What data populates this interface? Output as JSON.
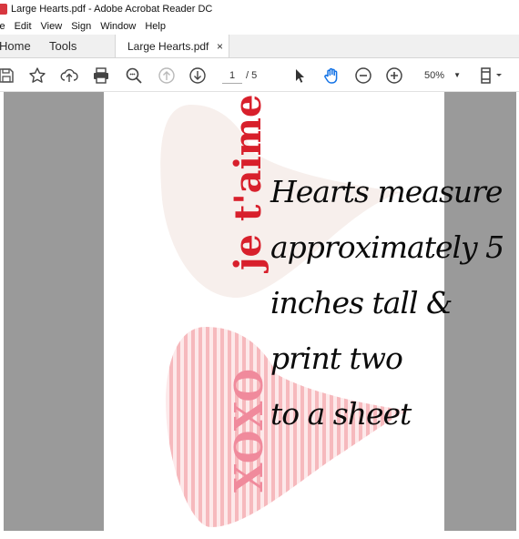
{
  "window": {
    "title": "Large Hearts.pdf - Adobe Acrobat Reader DC"
  },
  "menu": {
    "items": [
      "le",
      "Edit",
      "View",
      "Sign",
      "Window",
      "Help"
    ]
  },
  "tabs": {
    "home": "Home",
    "tools": "Tools",
    "document": "Large Hearts.pdf",
    "close_glyph": "×"
  },
  "toolbar": {
    "icons": [
      "save-icon",
      "bookmark-star-icon",
      "upload-icon",
      "print-icon",
      "find-icon",
      "previous-page-icon",
      "next-page-icon",
      "select-arrow-icon",
      "hand-icon",
      "zoom-out-icon",
      "zoom-in-icon",
      "page-fit-icon"
    ],
    "current_page": "1",
    "total_pages": "/ 5",
    "zoom": "50%",
    "zoom_caret": "▼",
    "accent": "#1473e6"
  },
  "pdf": {
    "heart_top_text": "je t'aime",
    "heart_bottom_text": "XOXO",
    "colors": {
      "heart_top": "#f7efec",
      "heart_bottom_stripe": "#f6b9bd",
      "text_red": "#d8202c",
      "text_pink": "#f08a9c"
    }
  },
  "overlay": {
    "lines": [
      "Hearts measure",
      "approximately 5",
      "inches tall &",
      "print two",
      "to a sheet"
    ]
  }
}
